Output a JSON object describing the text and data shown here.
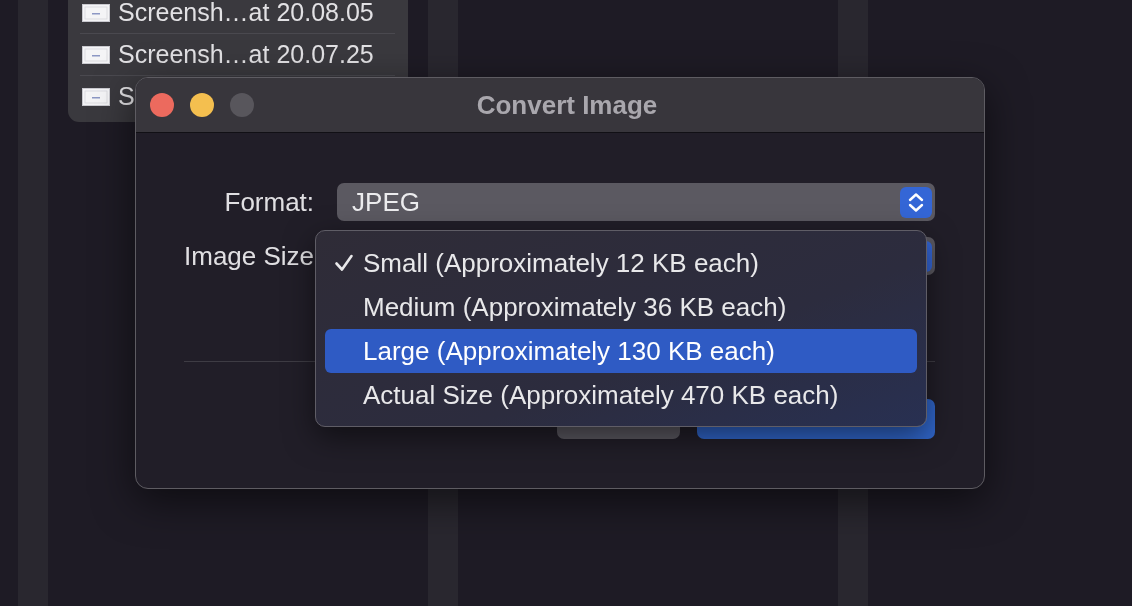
{
  "file_list": {
    "items": [
      {
        "name": "Screensh…at 20.08.05"
      },
      {
        "name": "Screensh…at 20.07.25"
      },
      {
        "name": "S"
      }
    ]
  },
  "dialog": {
    "title": "Convert Image",
    "window_controls": [
      {
        "kind": "close",
        "enabled": true
      },
      {
        "kind": "minimize",
        "enabled": true
      },
      {
        "kind": "zoom",
        "enabled": false
      }
    ],
    "fields": [
      {
        "label": "Format:",
        "value": "JPEG"
      },
      {
        "label": "Image Size"
      }
    ],
    "buttons": [
      {
        "kind": "secondary"
      },
      {
        "kind": "primary"
      }
    ],
    "popup_menu": {
      "items": [
        {
          "label": "Small (Approximately 12 KB each)",
          "checked": true,
          "selected": false
        },
        {
          "label": "Medium (Approximately 36 KB each)",
          "checked": false,
          "selected": false
        },
        {
          "label": "Large (Approximately 130 KB each)",
          "checked": false,
          "selected": true
        },
        {
          "label": "Actual Size (Approximately 470 KB each)",
          "checked": false,
          "selected": false
        }
      ]
    }
  }
}
